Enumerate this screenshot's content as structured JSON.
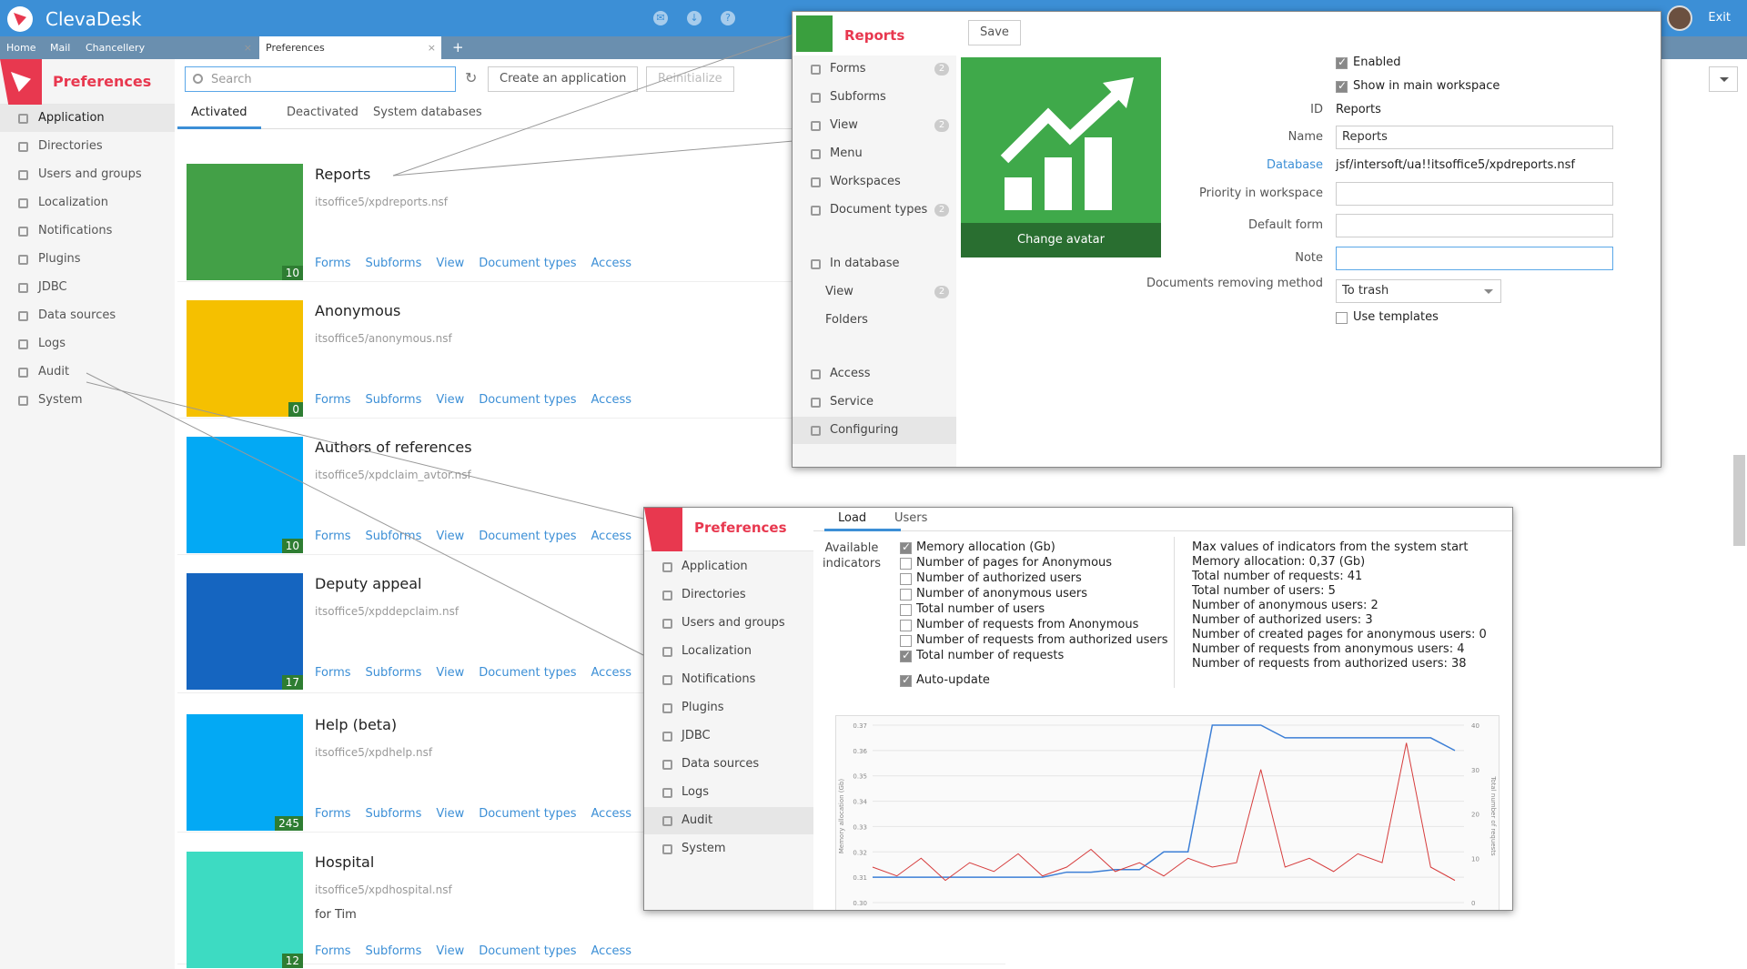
{
  "app": {
    "title": "ClevaDesk",
    "exit_label": "Exit"
  },
  "tabs": [
    {
      "label": "Home"
    },
    {
      "label": "Mail"
    },
    {
      "label": "Chancellery"
    },
    {
      "label": "Preferences"
    }
  ],
  "prefs": {
    "title": "Preferences"
  },
  "nav": [
    "Application",
    "Directories",
    "Users and groups",
    "Localization",
    "Notifications",
    "Plugins",
    "JDBC",
    "Data sources",
    "Logs",
    "Audit",
    "System"
  ],
  "toolbar": {
    "search_placeholder": "Search",
    "create": "Create an application",
    "reinit": "Reinitialize"
  },
  "subtabs": [
    "Activated",
    "Deactivated",
    "System databases"
  ],
  "links": [
    "Forms",
    "Subforms",
    "View",
    "Document types",
    "Access"
  ],
  "cards": [
    {
      "title": "Reports",
      "path": "itsoffice5/xpdreports.nsf",
      "count": "10",
      "color": "#43a047"
    },
    {
      "title": "Anonymous",
      "path": "itsoffice5/anonymous.nsf",
      "count": "0",
      "color": "#f5c000"
    },
    {
      "title": "Authors of references",
      "path": "itsoffice5/xpdclaim_avtor.nsf",
      "count": "10",
      "color": "#03a9f4"
    },
    {
      "title": "Deputy appeal",
      "path": "itsoffice5/xpddepclaim.nsf",
      "count": "17",
      "color": "#1565c0"
    },
    {
      "title": "Help (beta)",
      "path": "itsoffice5/xpdhelp.nsf",
      "count": "245",
      "color": "#03a9f4"
    },
    {
      "title": "Hospital",
      "path": "itsoffice5/xpdhospital.nsf",
      "count": "12",
      "color": "#3ddbc2",
      "extra": "for Tim"
    }
  ],
  "reports": {
    "title": "Reports",
    "save": "Save",
    "change_avatar": "Change avatar",
    "menu": [
      {
        "label": "Forms",
        "badge": "2"
      },
      {
        "label": "Subforms"
      },
      {
        "label": "View",
        "badge": "2"
      },
      {
        "label": "Menu"
      },
      {
        "label": "Workspaces"
      },
      {
        "label": "Document types",
        "badge": "2"
      },
      {
        "label": "In database"
      },
      {
        "label": "View",
        "badge": "2"
      },
      {
        "label": "Folders"
      },
      {
        "label": "Access"
      },
      {
        "label": "Service"
      },
      {
        "label": "Configuring"
      }
    ],
    "enabled": "Enabled",
    "show_main": "Show in main workspace",
    "id_label": "ID",
    "id_value": "Reports",
    "name_label": "Name",
    "name_value": "Reports",
    "db_label": "Database",
    "db_value": "jsf/intersoft/ua!!itsoffice5/xpdreports.nsf",
    "priority_label": "Priority in workspace",
    "default_form_label": "Default form",
    "note_label": "Note",
    "remove_label": "Documents removing method",
    "remove_value": "To trash",
    "templates": "Use templates"
  },
  "audit": {
    "tabs": [
      "Load",
      "Users"
    ],
    "avail_label": "Available indicators",
    "indicators": [
      {
        "label": "Memory allocation (Gb)",
        "checked": true
      },
      {
        "label": "Number of pages for Anonymous",
        "checked": false
      },
      {
        "label": "Number of authorized users",
        "checked": false
      },
      {
        "label": "Number of anonymous users",
        "checked": false
      },
      {
        "label": "Total number of users",
        "checked": false
      },
      {
        "label": "Number of requests from Anonymous",
        "checked": false
      },
      {
        "label": "Number of requests from authorized users",
        "checked": false
      },
      {
        "label": "Total number of requests",
        "checked": true
      }
    ],
    "auto_update": "Auto-update",
    "stats": [
      "Max values of indicators from the system start",
      "Memory allocation: 0,37 (Gb)",
      "Total number of requests: 41",
      "Total number of users: 5",
      "Number of anonymous users: 2",
      "Number of authorized users: 3",
      "Number of created pages for anonymous users: 0",
      "Number of requests from anonymous users: 4",
      "Number of requests from authorized users: 38"
    ]
  },
  "chart_data": {
    "type": "line",
    "ylabel": "Memory allocation (Gb)",
    "y2label": "Total number of requests",
    "ylim": [
      0.3,
      0.37
    ],
    "y2lim": [
      0,
      40
    ],
    "series": [
      {
        "color": "#3c7fd6",
        "values": [
          0.31,
          0.31,
          0.31,
          0.31,
          0.31,
          0.31,
          0.31,
          0.31,
          0.312,
          0.312,
          0.313,
          0.313,
          0.32,
          0.32,
          0.37,
          0.37,
          0.37,
          0.365,
          0.365,
          0.365,
          0.365,
          0.365,
          0.365,
          0.365,
          0.36
        ]
      },
      {
        "color": "#d63c3c",
        "values": [
          8,
          6,
          10,
          5,
          9,
          7,
          11,
          6,
          8,
          12,
          7,
          9,
          6,
          10,
          8,
          9,
          30,
          8,
          10,
          7,
          11,
          9,
          36,
          8,
          5
        ]
      }
    ]
  }
}
